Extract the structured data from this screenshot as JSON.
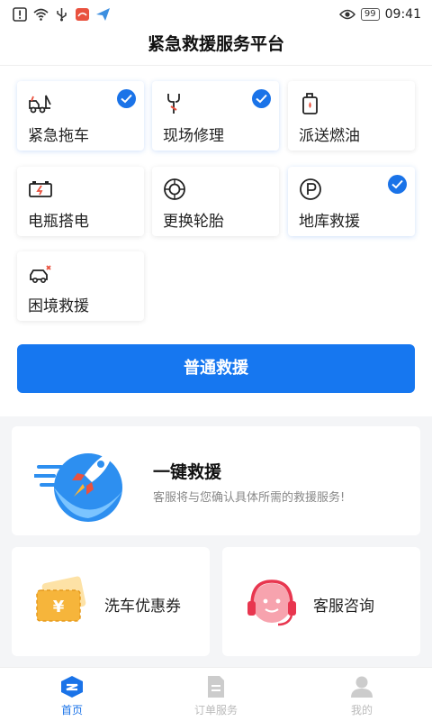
{
  "status_bar": {
    "battery": "99",
    "time": "09:41"
  },
  "header": {
    "title": "紧急救援服务平台"
  },
  "services": [
    {
      "label": "紧急拖车",
      "icon": "tow-truck-icon",
      "checked": true
    },
    {
      "label": "现场修理",
      "icon": "wrench-icon",
      "checked": true
    },
    {
      "label": "派送燃油",
      "icon": "fuel-can-icon",
      "checked": false
    },
    {
      "label": "电瓶搭电",
      "icon": "battery-icon",
      "checked": false
    },
    {
      "label": "更换轮胎",
      "icon": "tire-icon",
      "checked": false
    },
    {
      "label": "地库救援",
      "icon": "parking-icon",
      "checked": true
    },
    {
      "label": "困境救援",
      "icon": "stuck-car-icon",
      "checked": false
    }
  ],
  "primary_button": {
    "label": "普通救援"
  },
  "banner": {
    "title": "一键救援",
    "subtitle": "客服将与您确认具体所需的救援服务!"
  },
  "tiles": [
    {
      "label": "洗车优惠券",
      "icon": "coupon-icon"
    },
    {
      "label": "客服咨询",
      "icon": "headset-icon"
    }
  ],
  "bottom_nav": [
    {
      "label": "首页",
      "icon": "home-icon",
      "active": true
    },
    {
      "label": "订单服务",
      "icon": "order-icon",
      "active": false
    },
    {
      "label": "我的",
      "icon": "profile-icon",
      "active": false
    }
  ],
  "colors": {
    "accent": "#1677f0",
    "check": "#1a73e8",
    "coupon": "#f6b53b",
    "headset": "#e8364f"
  }
}
